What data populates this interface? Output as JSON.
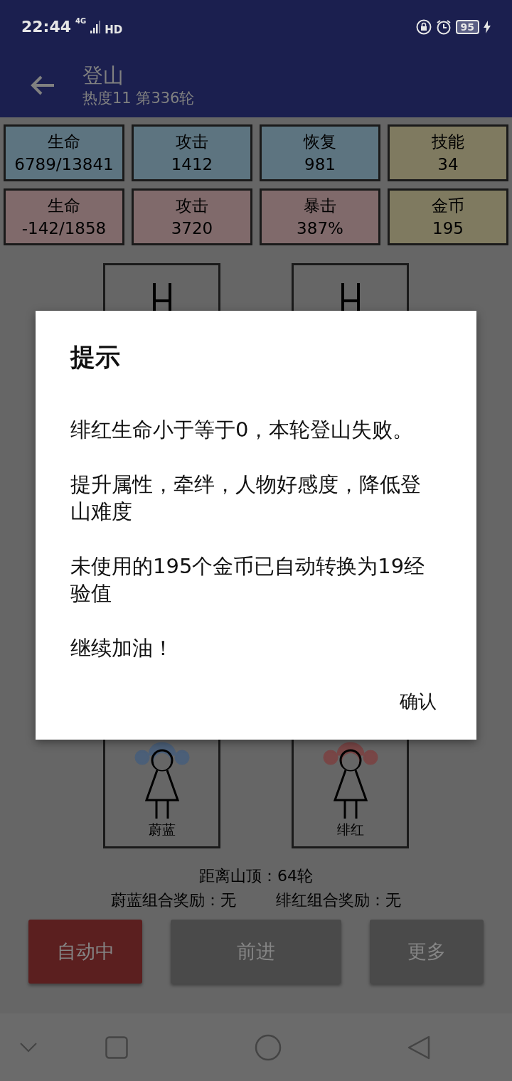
{
  "status_bar": {
    "time": "22:44",
    "network": "4G",
    "hd": "HD",
    "battery": "95"
  },
  "app_bar": {
    "title": "登山",
    "subtitle": "热度11 第336轮"
  },
  "stats": [
    {
      "label": "生命",
      "value": "6789/13841",
      "kind": "team"
    },
    {
      "label": "攻击",
      "value": "1412",
      "kind": "team"
    },
    {
      "label": "恢复",
      "value": "981",
      "kind": "team"
    },
    {
      "label": "技能",
      "value": "34",
      "kind": "resource"
    },
    {
      "label": "生命",
      "value": "-142/1858",
      "kind": "enemy"
    },
    {
      "label": "攻击",
      "value": "3720",
      "kind": "enemy"
    },
    {
      "label": "暴击",
      "value": "387%",
      "kind": "enemy"
    },
    {
      "label": "金币",
      "value": "195",
      "kind": "resource"
    }
  ],
  "lanes": [
    {
      "name": "蔚蓝",
      "color": "#4b5f78"
    },
    {
      "name": "绯红",
      "color": "#784646"
    }
  ],
  "distance": "距离山顶：64轮",
  "rewards": [
    "蔚蓝组合奖励：无",
    "绯红组合奖励：无"
  ],
  "buttons": [
    {
      "label": "自动中",
      "kind": "active"
    },
    {
      "label": "前进",
      "kind": "normal"
    },
    {
      "label": "更多",
      "kind": "normal"
    }
  ],
  "dialog": {
    "title": "提示",
    "paragraphs": [
      "绯红生命小于等于0，本轮登山失败。",
      "提升属性，牵绊，人物好感度，降低登山难度",
      "未使用的195个金币已自动转换为19经验值",
      "继续加油！"
    ],
    "button": "确认"
  }
}
